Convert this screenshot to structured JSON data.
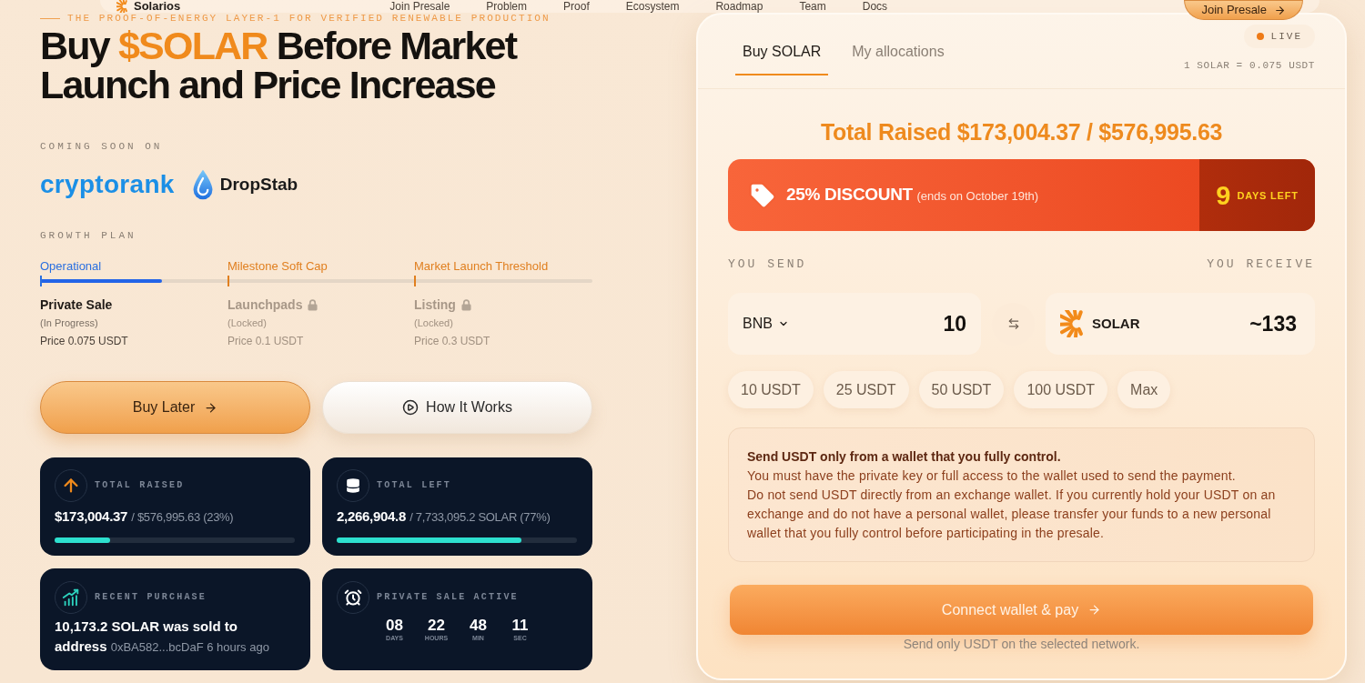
{
  "nav": {
    "logo": "Solarios",
    "links": [
      "Join Presale",
      "Problem",
      "Proof",
      "Ecosystem",
      "Roadmap",
      "Team",
      "Docs"
    ],
    "cta": "Join Presale"
  },
  "hero": {
    "tagline": "THE PROOF-OF-ENERGY LAYER-1 FOR VERIFIED RENEWABLE PRODUCTION",
    "headline_lead": "Buy",
    "headline_highlight": "$SOLAR",
    "headline_rest": "Before Market Launch and Price Increase"
  },
  "listings": {
    "label": "COMING SOON ON",
    "partners": [
      {
        "kind": "wordmark",
        "name": "cryptorank"
      },
      {
        "kind": "drop",
        "name": "DropStab"
      }
    ]
  },
  "growth_plan": {
    "label": "GROWTH PLAN",
    "level": 0.22,
    "stages": [
      {
        "milestone": "Operational",
        "name": "Private Sale",
        "status": "(In Progress)",
        "price": "Price 0.075 USDT",
        "locked": false
      },
      {
        "milestone": "Milestone Soft Cap",
        "name": "Launchpads",
        "status": "(Locked)",
        "price": "Price 0.1 USDT",
        "locked": true
      },
      {
        "milestone": "Market Launch Threshold",
        "name": "Listing",
        "status": "(Locked)",
        "price": "Price 0.3 USDT",
        "locked": true
      }
    ]
  },
  "actions": [
    {
      "kind": "primary",
      "label": "Buy Later"
    },
    {
      "kind": "secondary",
      "label": "How It Works"
    }
  ],
  "stats": [
    {
      "kind": "raised",
      "label": "TOTAL RAISED",
      "value": "$173,004.37",
      "detail": "/ $576,995.63 (23%)",
      "level": 0.23
    },
    {
      "kind": "supply",
      "label": "TOTAL LEFT",
      "value": "2,266,904.8",
      "detail": "/ 7,733,095.2 SOLAR (77%)",
      "level": 0.77
    },
    {
      "kind": "purchase",
      "label": "RECENT PURCHASE",
      "value": "10,173.2 SOLAR was sold to address",
      "detail": "0xBA582...bcDaF 6 hours ago"
    },
    {
      "kind": "countdown",
      "label": "PRIVATE SALE ACTIVE",
      "units": [
        {
          "value": "08",
          "unit": "DAYS"
        },
        {
          "value": "22",
          "unit": "HOURS"
        },
        {
          "value": "48",
          "unit": "MIN"
        },
        {
          "value": "11",
          "unit": "SEC"
        }
      ]
    }
  ],
  "purchase_panel": {
    "tabs": [
      {
        "label": "Buy SOLAR",
        "selected": true
      },
      {
        "label": "My allocations",
        "selected": false
      }
    ],
    "status": "LIVE",
    "rate": "1 SOLAR = 0.075 USDT",
    "total_raised": "Total Raised $173,004.37 / $576,995.63",
    "discount": {
      "title": "25% DISCOUNT",
      "note": "(ends on October 19th)",
      "days": "9",
      "days_label": "DAYS LEFT"
    },
    "send_label": "YOU SEND",
    "receive_label": "YOU RECEIVE",
    "send": {
      "currency": "BNB",
      "amount": "10"
    },
    "receive": {
      "token": "SOLAR",
      "amount": "~133"
    },
    "presets": [
      "10 USDT",
      "25 USDT",
      "50 USDT",
      "100 USDT",
      "Max"
    ],
    "notice": {
      "title": "Send USDT only from a wallet that you fully control.",
      "paragraphs": [
        "You must have the private key or full access to the wallet used to send the payment.",
        "Do not send USDT directly from an exchange wallet. If you currently hold your USDT on an exchange and do not have a personal wallet, please transfer your funds to a new personal wallet that you fully control before participating in the presale."
      ]
    },
    "submit": "Connect wallet & pay",
    "footnote": "Send only USDT on the selected network."
  }
}
